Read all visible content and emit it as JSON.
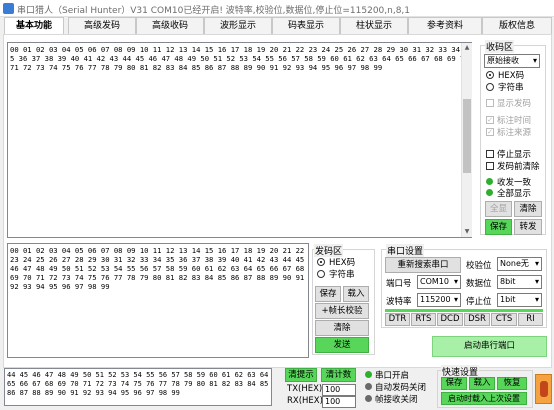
{
  "window": {
    "title": "串口猎人（Serial Hunter）V31    COM10已经开启!   波特率,校验位,数据位,停止位=115200,n,8,1"
  },
  "tabs": [
    "基本功能",
    "高级发码",
    "高级收码",
    "波形显示",
    "码表显示",
    "柱状显示",
    "参考资料",
    "版权信息"
  ],
  "receive_area": {
    "text": "00 01 02 03 04 05 06 07 08 09 10 11 12 13 14 15 16 17 18 19 20 21 22 23 24 25 26 27 28 29 30 31 32 33 34 35 36 37 38 39 40 41 42 43 44 45 46 47 48 49 50 51 52 53 54 55 56 57 58 59 60 61 62 63 64 65 66 67 68 69 70 71 72 73 74 75 76 77 78 79 80 81 82 83 84 85 86 87 88 89 90 91 92 93 94 95 96 97 98 99"
  },
  "recv_panel": {
    "title": "收码区",
    "mode_select": "原始接收",
    "hex_label": "HEX码",
    "str_label": "字符串",
    "show_send_label": "显示发码",
    "mark_time_label": "标注时间",
    "mark_source_label": "标注来源",
    "stop_show_label": "停止显示",
    "clear_before_send_label": "发码前清除",
    "recv_consistent_label": "收发一致",
    "show_all_label": "全部显示",
    "select_all_label": "全显",
    "clear_label": "清除",
    "save_label": "保存",
    "transfer_label": "转发"
  },
  "send_area": {
    "text": "00 01 02 03 04 05 06 07 08 09 10 11 12 13 14 15 16 17 18 19 20 21 22 23 24 25 26 27 28 29 30 31 32 33 34 35 36 37 38 39 40 41 42 43 44 45 46 47 48 49 50 51 52 53 54 55 56 57 58 59 60 61 62 63 64 65 66 67 68 69 70 71 72 73 74 75 76 77 78 79 80 81 82 83 84 85 86 87 88 89 90 91 92 93 94 95 96 97 98 99"
  },
  "send_panel": {
    "title": "发码区",
    "hex_label": "HEX码",
    "str_label": "字符串",
    "save_label": "保存",
    "load_label": "载入",
    "add_check_label": "+帧长校验",
    "clear_label": "清除",
    "send_label": "发送"
  },
  "serial_settings": {
    "title": "串口设置",
    "rescan_label": "重新搜索串口",
    "parity_label": "校验位",
    "parity_value": "None无",
    "port_label": "端口号",
    "port_value": "COM10",
    "databits_label": "数据位",
    "databits_value": "8bit",
    "baud_label": "波特率",
    "baud_value": "115200",
    "stopbits_label": "停止位",
    "stopbits_value": "1bit",
    "signals": [
      "DTR",
      "RTS",
      "DCD",
      "DSR",
      "CTS",
      "RI"
    ],
    "open_port_label": "启动串行端口"
  },
  "status": {
    "log_text": "44 45 46 47 48 49 50 51 52 53 54 55 56 57 58 59 60 61 62 63 64 65 66 67 68 69 70 71 72 73 74 75 76 77 78 79 80 81 82 83 84 85 86 87 88 89 90 91 92 93 94 95 96 97 98 99",
    "clear_tip_label": "清提示",
    "clear_count_label": "清计数",
    "tx_label": "TX(HEX):",
    "tx_value": "100",
    "rx_label": "RX(HEX):",
    "rx_value": "100",
    "port_open_label": "串口开启",
    "auto_send_label": "自动发码关闭",
    "frame_recv_label": "帧接收关闭"
  },
  "quick_settings": {
    "title": "快速设置",
    "save_label": "保存",
    "load_label": "载入",
    "restore_label": "恢复",
    "auto_load_label": "启动时载入上次设置"
  },
  "colors": {
    "accent_green": "#57d65a",
    "led_green": "#2fae2f"
  }
}
